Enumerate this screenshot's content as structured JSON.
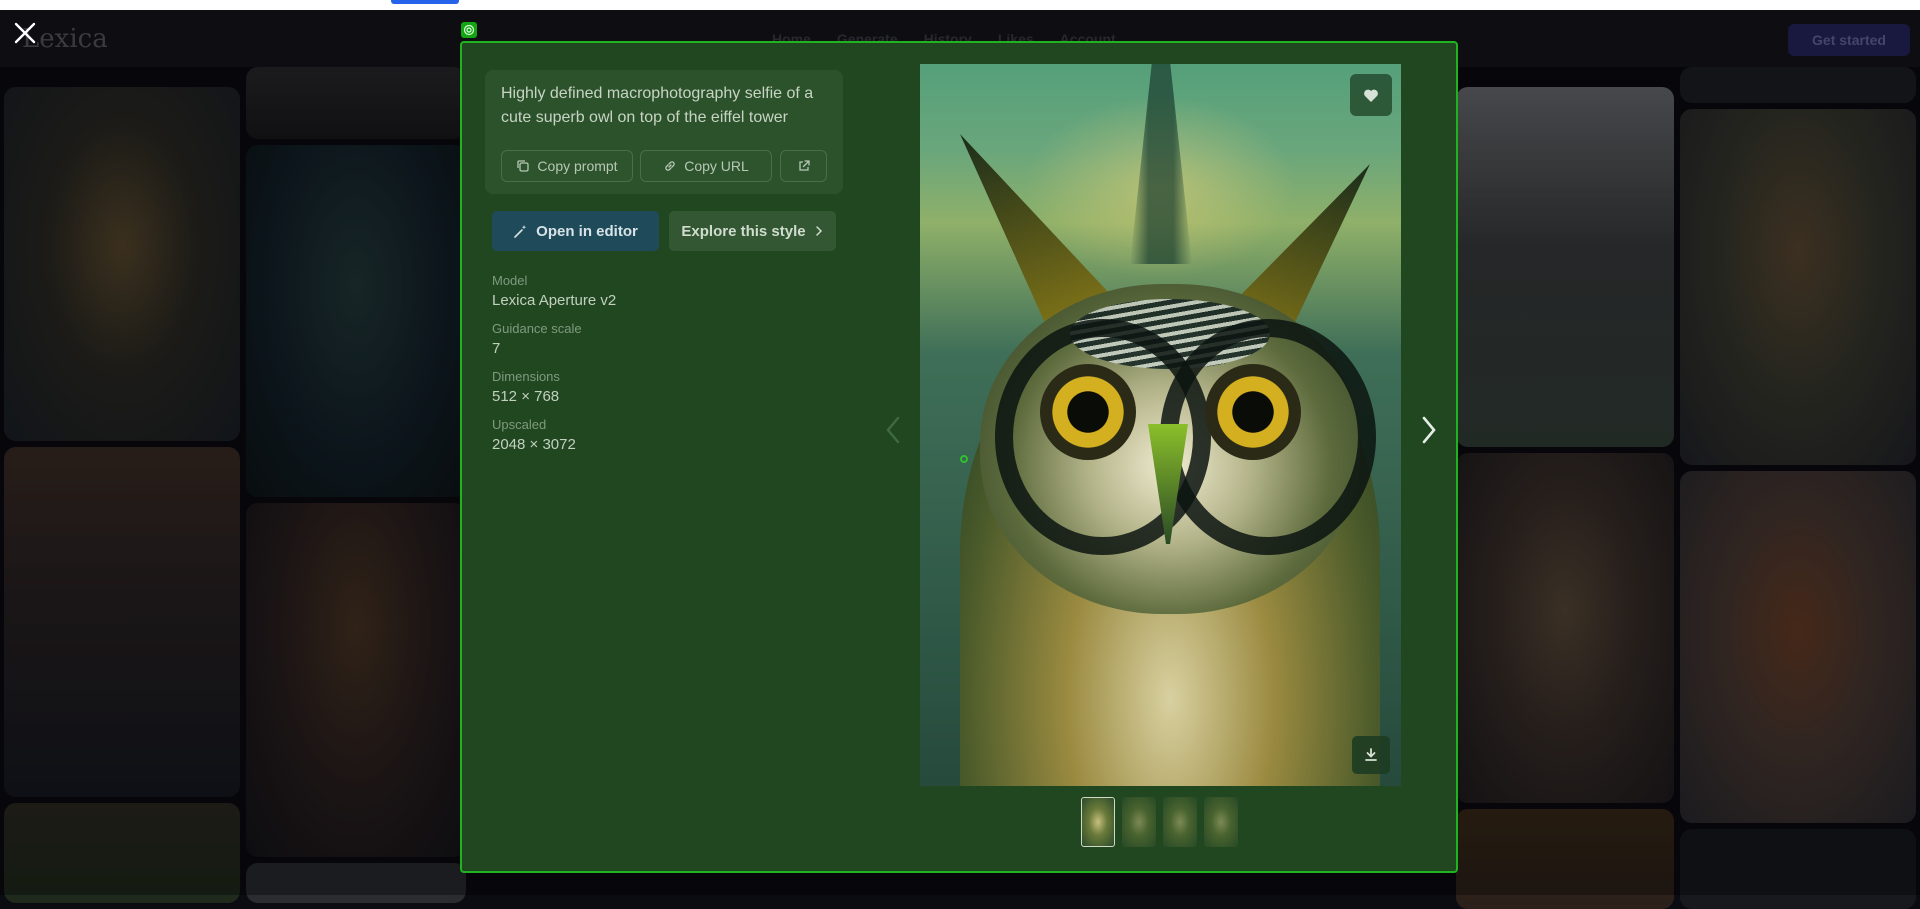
{
  "site": {
    "logo": "Lexica",
    "nav": [
      "Home",
      "Generate",
      "History",
      "Likes",
      "Account"
    ],
    "get_started": "Get started"
  },
  "modal": {
    "prompt": "Highly defined macrophotography selfie of a cute superb owl on top of the eiffel tower",
    "copy_prompt_label": "Copy prompt",
    "copy_url_label": "Copy URL",
    "open_editor_label": "Open in editor",
    "explore_style_label": "Explore this style",
    "meta": [
      {
        "label": "Model",
        "value": "Lexica Aperture v2"
      },
      {
        "label": "Guidance scale",
        "value": "7"
      },
      {
        "label": "Dimensions",
        "value": "512 × 768"
      },
      {
        "label": "Upscaled",
        "value": "2048 × 3072"
      }
    ],
    "thumbnails_count": 4,
    "selected_thumbnail": 1
  },
  "icons": {
    "close": "close-icon",
    "copy": "copy-icon",
    "link": "link-icon",
    "external": "external-link-icon",
    "wand": "magic-wand-icon",
    "chevron": "chevron-right-icon",
    "heart": "heart-icon",
    "download": "download-icon"
  },
  "colors": {
    "modal_bg": "#214721",
    "modal_border": "#1fb31f",
    "editor_button": "#1e4a5a"
  }
}
